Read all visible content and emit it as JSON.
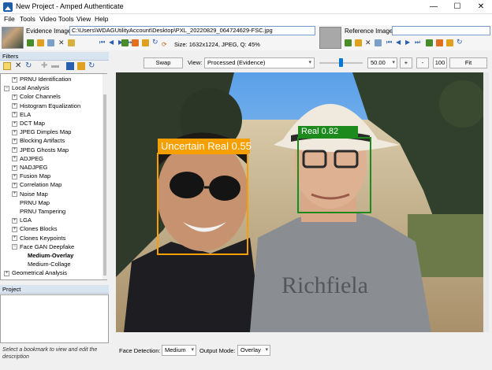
{
  "window": {
    "title": "New Project - Amped Authenticate",
    "min": "—",
    "max": "☐",
    "close": "✕"
  },
  "menu": [
    "File",
    "Tools",
    "Video Tools",
    "View",
    "Help"
  ],
  "evidence": {
    "label": "Evidence Image:",
    "path": "C:\\Users\\WDAGUtilityAccount\\Desktop\\PXL_20220829_064724629-FSC.jpg",
    "info": "Size: 1632x1224, JPEG, Q: 45%"
  },
  "reference": {
    "label": "Reference Image:"
  },
  "filters": {
    "header": "Filters"
  },
  "tree": [
    {
      "label": "PRNU Identification",
      "indent": 2,
      "exp": "+"
    },
    {
      "label": "Local Analysis",
      "indent": 1,
      "exp": "−"
    },
    {
      "label": "Color Channels",
      "indent": 2,
      "exp": "+"
    },
    {
      "label": "Histogram Equalization",
      "indent": 2,
      "exp": "+"
    },
    {
      "label": "ELA",
      "indent": 2,
      "exp": "+"
    },
    {
      "label": "DCT Map",
      "indent": 2,
      "exp": "+"
    },
    {
      "label": "JPEG Dimples Map",
      "indent": 2,
      "exp": "+"
    },
    {
      "label": "Blocking Artifacts",
      "indent": 2,
      "exp": "+"
    },
    {
      "label": "JPEG Ghosts Map",
      "indent": 2,
      "exp": "+"
    },
    {
      "label": "ADJPEG",
      "indent": 2,
      "exp": "+"
    },
    {
      "label": "NADJPEG",
      "indent": 2,
      "exp": "+"
    },
    {
      "label": "Fusion Map",
      "indent": 2,
      "exp": "+"
    },
    {
      "label": "Correlation Map",
      "indent": 2,
      "exp": "+"
    },
    {
      "label": "Noise Map",
      "indent": 2,
      "exp": "+"
    },
    {
      "label": "PRNU Map",
      "indent": 2,
      "exp": ""
    },
    {
      "label": "PRNU Tampering",
      "indent": 2,
      "exp": ""
    },
    {
      "label": "LGA",
      "indent": 2,
      "exp": "+"
    },
    {
      "label": "Clones Blocks",
      "indent": 2,
      "exp": "+"
    },
    {
      "label": "Clones Keypoints",
      "indent": 2,
      "exp": "+"
    },
    {
      "label": "Face GAN Deepfake",
      "indent": 2,
      "exp": "−"
    },
    {
      "label": "Medium-Overlay",
      "indent": 3,
      "exp": "",
      "bold": true
    },
    {
      "label": "Medium-Collage",
      "indent": 3,
      "exp": ""
    },
    {
      "label": "Geometrical Analysis",
      "indent": 1,
      "exp": "+"
    }
  ],
  "project": {
    "header": "Project",
    "hint": "Select a bookmark to view and edit the description"
  },
  "viewbar": {
    "swap": "Swap",
    "view_label": "View:",
    "view_value": "Processed (Evidence)",
    "zoom": "50.00",
    "plus": "+",
    "minus": "-",
    "hundred": "100",
    "fit": "Fit",
    "slider_fraction": 0.5
  },
  "faces": [
    {
      "label": "Uncertain Real 0.55",
      "color": "#f5a000"
    },
    {
      "label": "Real 0.82",
      "color": "#1c8a1c"
    }
  ],
  "bottom": {
    "face_label": "Face Detection:",
    "face_value": "Medium",
    "mode_label": "Output Mode:",
    "mode_value": "Overlay"
  }
}
